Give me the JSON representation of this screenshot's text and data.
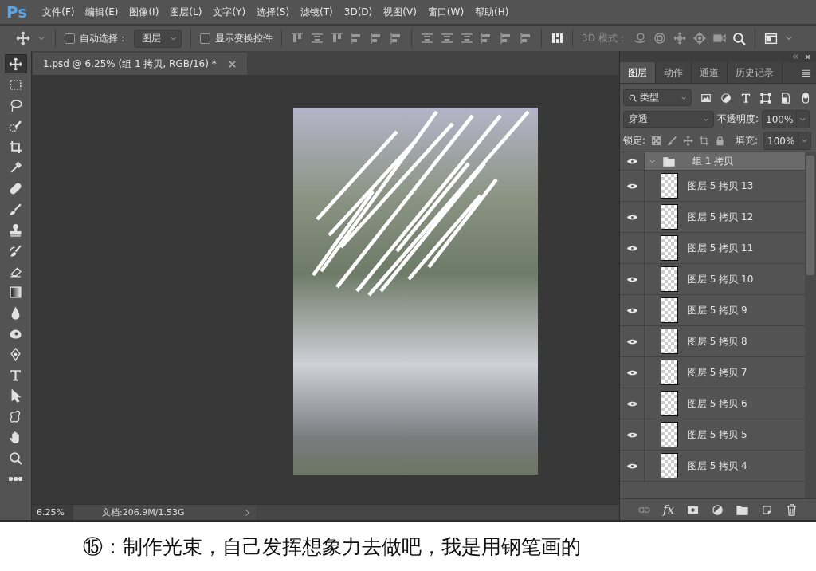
{
  "app_logo": "Ps",
  "menu_bar": {
    "items": [
      "文件(F)",
      "编辑(E)",
      "图像(I)",
      "图层(L)",
      "文字(Y)",
      "选择(S)",
      "滤镜(T)",
      "3D(D)",
      "视图(V)",
      "窗口(W)",
      "帮助(H)"
    ]
  },
  "options_bar": {
    "auto_select": {
      "label": "自动选择：",
      "checked": false
    },
    "auto_select_target": "图层",
    "show_transform": {
      "label": "显示变换控件",
      "checked": false
    },
    "mode_3d_label": "3D 模式："
  },
  "tools": [
    {
      "selected": true
    },
    {
      "selected": false
    },
    {
      "selected": false
    },
    {
      "selected": false
    },
    {
      "selected": false
    },
    {
      "selected": false
    },
    {
      "selected": false
    },
    {
      "selected": false
    },
    {
      "selected": false
    },
    {
      "selected": false
    },
    {
      "selected": false
    },
    {
      "selected": false
    },
    {
      "selected": false
    },
    {
      "selected": false
    },
    {
      "selected": false
    },
    {
      "selected": false
    },
    {
      "selected": false
    },
    {
      "selected": false
    },
    {
      "selected": false
    },
    {
      "selected": false
    },
    {
      "selected": false
    }
  ],
  "document": {
    "tab_title": "1.psd @ 6.25% (组 1 拷贝, RGB/16) *",
    "close": "×",
    "zoom": "6.25%",
    "doc_info": "文档:206.9M/1.53G"
  },
  "layers_panel": {
    "tabs": [
      {
        "label": "图层",
        "selected": true
      },
      {
        "label": "动作",
        "selected": false
      },
      {
        "label": "通道",
        "selected": false
      },
      {
        "label": "历史记录",
        "selected": false
      }
    ],
    "filter_kind": "类型",
    "blend_mode": "穿透",
    "opacity_label": "不透明度:",
    "opacity": "100%",
    "lock_label": "锁定:",
    "fill_label": "填充:",
    "fill": "100%",
    "fx_label": "fx",
    "group": {
      "name": "组 1 拷贝",
      "visible": true,
      "expanded": true,
      "selected": true,
      "children": [
        {
          "name": "图层 5 拷贝 13",
          "visible": true
        },
        {
          "name": "图层 5 拷贝 12",
          "visible": true
        },
        {
          "name": "图层 5 拷贝 11",
          "visible": true
        },
        {
          "name": "图层 5 拷贝 10",
          "visible": true
        },
        {
          "name": "图层 5 拷贝 9",
          "visible": true
        },
        {
          "name": "图层 5 拷贝 8",
          "visible": true
        },
        {
          "name": "图层 5 拷贝 7",
          "visible": true
        },
        {
          "name": "图层 5 拷贝 6",
          "visible": true
        },
        {
          "name": "图层 5 拷贝 5",
          "visible": true
        },
        {
          "name": "图层 5 拷贝 4",
          "visible": true
        }
      ]
    }
  },
  "caption": "⑮：制作光束，自己发挥想象力去做吧，我是用钢笔画的"
}
